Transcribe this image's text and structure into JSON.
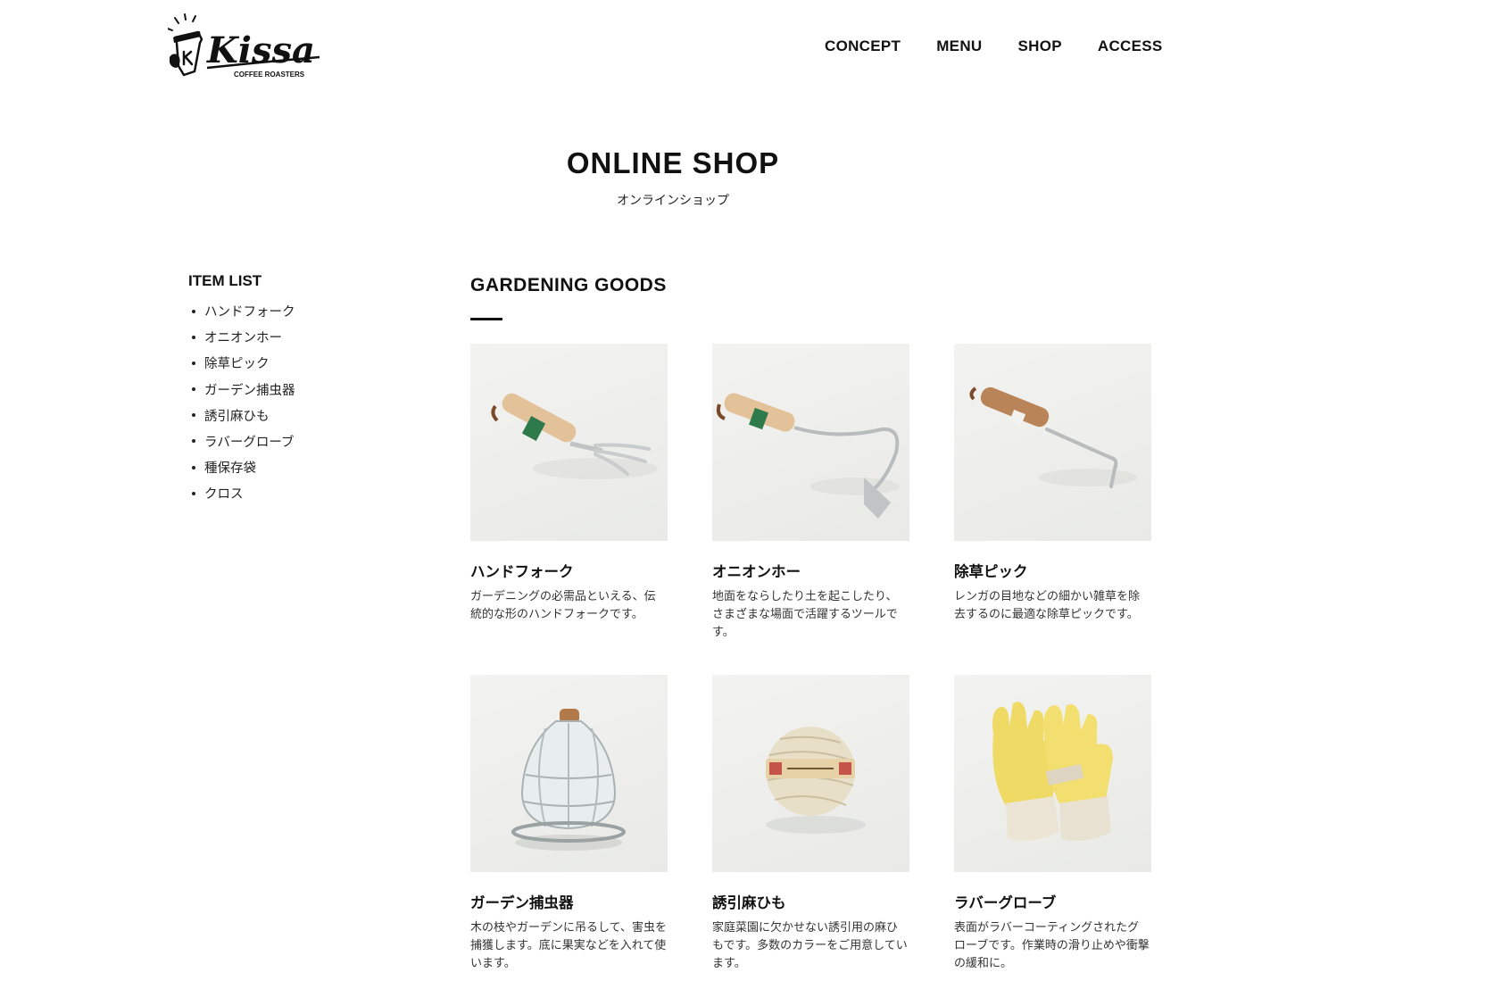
{
  "brand": {
    "logo_text": "Kissa",
    "logo_sub": "COFFEE ROASTERS"
  },
  "nav": [
    {
      "label": "CONCEPT"
    },
    {
      "label": "MENU"
    },
    {
      "label": "SHOP"
    },
    {
      "label": "ACCESS"
    }
  ],
  "page": {
    "title": "ONLINE SHOP",
    "subtitle": "オンラインショップ"
  },
  "sidebar": {
    "title": "ITEM LIST",
    "items": [
      {
        "label": "ハンドフォーク"
      },
      {
        "label": "オニオンホー"
      },
      {
        "label": "除草ピック"
      },
      {
        "label": "ガーデン捕虫器"
      },
      {
        "label": "誘引麻ひも"
      },
      {
        "label": "ラバーグローブ"
      },
      {
        "label": "種保存袋"
      },
      {
        "label": "クロス"
      }
    ]
  },
  "section": {
    "title": "GARDENING GOODS"
  },
  "products": [
    {
      "name": "ハンドフォーク",
      "desc": "ガーデニングの必需品といえる、伝統的な形のハンドフォークです。",
      "icon": "hand-fork-photo"
    },
    {
      "name": "オニオンホー",
      "desc": "地面をならしたり土を起こしたり、さまざまな場面で活躍するツールです。",
      "icon": "onion-hoe-photo"
    },
    {
      "name": "除草ピック",
      "desc": "レンガの目地などの細かい雑草を除去するのに最適な除草ピックです。",
      "icon": "weeding-pick-photo"
    },
    {
      "name": "ガーデン捕虫器",
      "desc": "木の枝やガーデンに吊るして、害虫を捕獲します。底に果実などを入れて使います。",
      "icon": "insect-trap-photo"
    },
    {
      "name": "誘引麻ひも",
      "desc": "家庭菜園に欠かせない誘引用の麻ひもです。多数のカラーをご用意しています。",
      "icon": "twine-photo"
    },
    {
      "name": "ラバーグローブ",
      "desc": "表面がラバーコーティングされたグローブです。作業時の滑り止めや衝撃の緩和に。",
      "icon": "rubber-glove-photo"
    }
  ]
}
